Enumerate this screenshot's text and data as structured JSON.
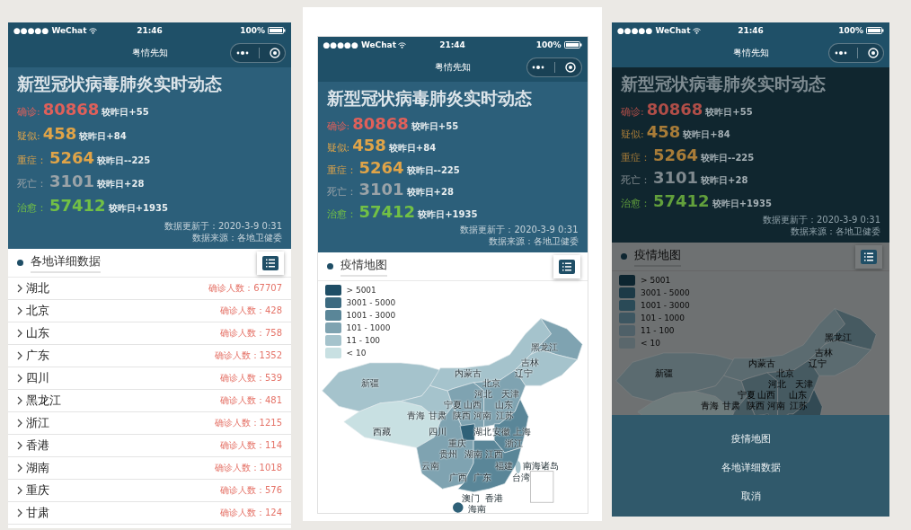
{
  "phones": [
    {
      "status_bar": {
        "carrier": "●●●●● WeChat",
        "time": "21:46",
        "battery": "100%"
      },
      "nav_title": "粤情先知",
      "header": {
        "title": "新型冠状病毒肺炎实时动态",
        "stats": [
          {
            "label": "确诊:",
            "value": "80868",
            "change": "较昨日+55",
            "color": "#e0605a"
          },
          {
            "label": "疑似:",
            "value": "458",
            "change": "较昨日+84",
            "color": "#e0a448"
          },
          {
            "label": "重症：",
            "value": "5264",
            "change": "较昨日--225",
            "color": "#e0a448"
          },
          {
            "label": "死亡：",
            "value": "3101",
            "change": "较昨日+28",
            "color": "#9aa3a8"
          },
          {
            "label": "治愈：",
            "value": "57412",
            "change": "较昨日+1935",
            "color": "#72c045"
          }
        ],
        "updated": "数据更新于：2020-3-9 0:31",
        "source": "数据来源：各地卫健委"
      },
      "section": {
        "kind": "list",
        "title": "各地详细数据",
        "rows": [
          {
            "name": "湖北",
            "count": "确诊人数：67707"
          },
          {
            "name": "北京",
            "count": "确诊人数：428"
          },
          {
            "name": "山东",
            "count": "确诊人数：758"
          },
          {
            "name": "广东",
            "count": "确诊人数：1352"
          },
          {
            "name": "四川",
            "count": "确诊人数：539"
          },
          {
            "name": "黑龙江",
            "count": "确诊人数：481"
          },
          {
            "name": "浙江",
            "count": "确诊人数：1215"
          },
          {
            "name": "香港",
            "count": "确诊人数：114"
          },
          {
            "name": "湖南",
            "count": "确诊人数：1018"
          },
          {
            "name": "重庆",
            "count": "确诊人数：576"
          },
          {
            "name": "甘肃",
            "count": "确诊人数：124"
          }
        ]
      }
    },
    {
      "status_bar": {
        "carrier": "●●●●● WeChat",
        "time": "21:44",
        "battery": "100%"
      },
      "nav_title": "粤情先知",
      "header": {
        "title": "新型冠状病毒肺炎实时动态",
        "stats": [
          {
            "label": "确诊:",
            "value": "80868",
            "change": "较昨日+55",
            "color": "#e0605a"
          },
          {
            "label": "疑似:",
            "value": "458",
            "change": "较昨日+84",
            "color": "#e0a448"
          },
          {
            "label": "重症：",
            "value": "5264",
            "change": "较昨日--225",
            "color": "#e0a448"
          },
          {
            "label": "死亡：",
            "value": "3101",
            "change": "较昨日+28",
            "color": "#9aa3a8"
          },
          {
            "label": "治愈：",
            "value": "57412",
            "change": "较昨日+1935",
            "color": "#72c045"
          }
        ],
        "updated": "数据更新于：2020-3-9 0:31",
        "source": "数据来源：各地卫健委"
      },
      "section": {
        "kind": "map",
        "title": "疫情地图",
        "legend": [
          {
            "label": "> 5001",
            "color": "#1f4e66"
          },
          {
            "label": "3001 - 5000",
            "color": "#3c6a80"
          },
          {
            "label": "1001 - 3000",
            "color": "#5a8698"
          },
          {
            "label": "101 - 1000",
            "color": "#7fa3b1"
          },
          {
            "label": "11 - 100",
            "color": "#a5c3cc"
          },
          {
            "label": "< 10",
            "color": "#c8e0e2"
          }
        ],
        "map_labels": [
          "黑龙江",
          "吉林",
          "内蒙古",
          "辽宁",
          "新疆",
          "北京",
          "河北",
          "天津",
          "宁夏",
          "山西",
          "山东",
          "青海",
          "甘肃",
          "陕西",
          "河南",
          "江苏",
          "西藏",
          "四川",
          "湖北",
          "安徽",
          "上海",
          "重庆",
          "浙江",
          "贵州",
          "湖南",
          "江西",
          "云南",
          "福建",
          "南海诸岛",
          "广西",
          "广东",
          "台湾",
          "澳门",
          "香港",
          "海南"
        ]
      }
    },
    {
      "status_bar": {
        "carrier": "●●●●● WeChat",
        "time": "21:46",
        "battery": "100%"
      },
      "nav_title": "粤情先知",
      "header": {
        "title": "新型冠状病毒肺炎实时动态",
        "stats": [
          {
            "label": "确诊:",
            "value": "80868",
            "change": "较昨日+55",
            "color": "#b04e48"
          },
          {
            "label": "疑似:",
            "value": "458",
            "change": "较昨日+84",
            "color": "#a87c38"
          },
          {
            "label": "重症：",
            "value": "5264",
            "change": "较昨日--225",
            "color": "#a87c38"
          },
          {
            "label": "死亡：",
            "value": "3101",
            "change": "较昨日+28",
            "color": "#808a8f"
          },
          {
            "label": "治愈：",
            "value": "57412",
            "change": "较昨日+1935",
            "color": "#62a03c"
          }
        ],
        "updated": "数据更新于：2020-3-9 0:31",
        "source": "数据来源：各地卫健委"
      },
      "section": {
        "kind": "map",
        "title": "疫情地图",
        "legend": [
          {
            "label": "> 5001",
            "color": "#0d2530"
          },
          {
            "label": "3001 - 5000",
            "color": "#1c3a47"
          },
          {
            "label": "1001 - 3000",
            "color": "#2a4a57"
          },
          {
            "label": "101 - 1000",
            "color": "#3d5661"
          },
          {
            "label": "11 - 100",
            "color": "#4f6068"
          },
          {
            "label": "< 10",
            "color": "#5a676c"
          }
        ],
        "map_labels": [
          "黑龙江",
          "吉林",
          "内蒙古",
          "辽宁",
          "新疆",
          "北京",
          "河北",
          "天津",
          "宁夏",
          "山西",
          "山东",
          "青海",
          "甘肃",
          "陕西",
          "河南",
          "江苏"
        ]
      },
      "action_sheet": {
        "items": [
          "疫情地图",
          "各地详细数据"
        ],
        "cancel": "取消"
      }
    }
  ]
}
